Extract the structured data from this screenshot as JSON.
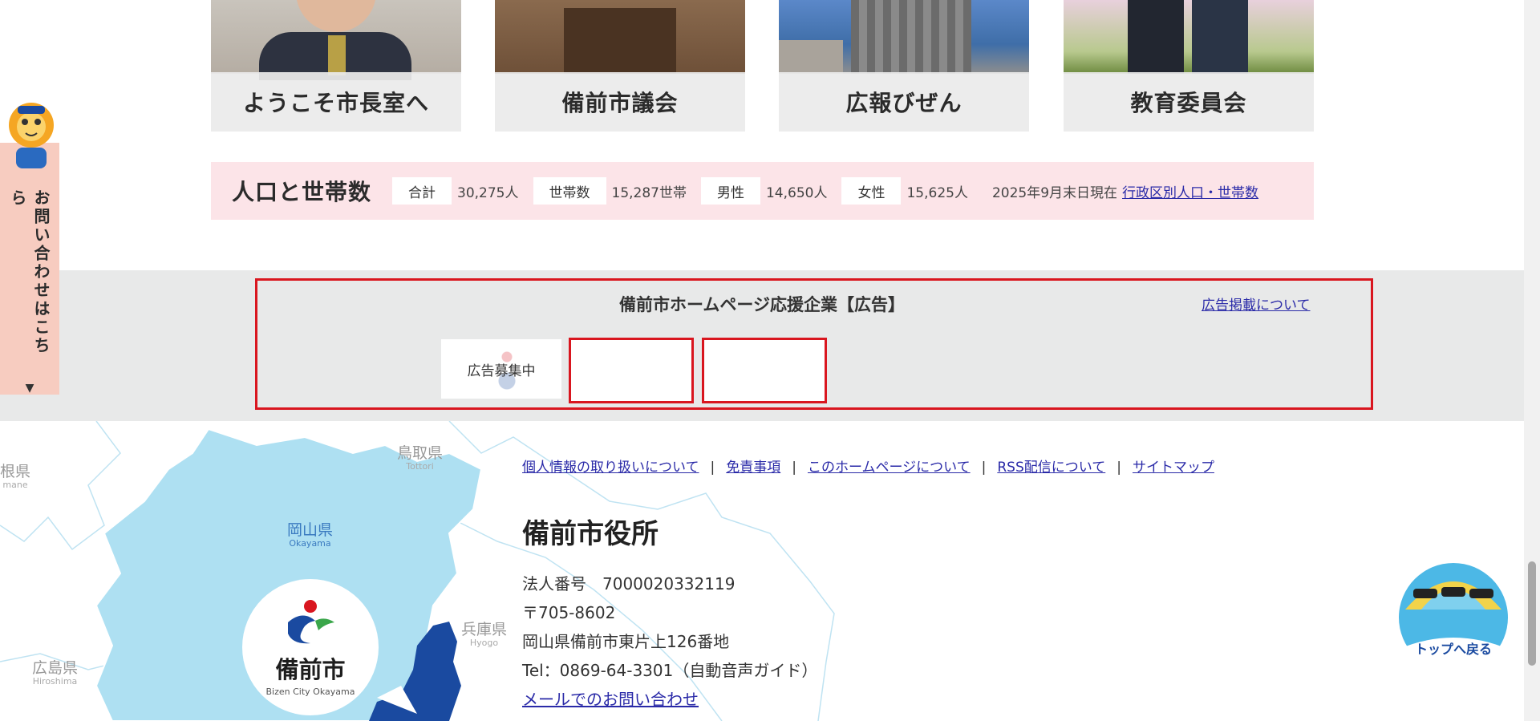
{
  "cards": [
    {
      "label": "ようこそ市長室へ"
    },
    {
      "label": "備前市議会"
    },
    {
      "label": "広報びぜん"
    },
    {
      "label": "教育委員会"
    }
  ],
  "population": {
    "title": "人口と世帯数",
    "total_label": "合計",
    "total_value": "30,275人",
    "households_label": "世帯数",
    "households_value": "15,287世帯",
    "male_label": "男性",
    "male_value": "14,650人",
    "female_label": "女性",
    "female_value": "15,625人",
    "as_of": "2025年9月末日現在",
    "link": "行政区別人口・世帯数"
  },
  "ads": {
    "title": "備前市ホームページ応援企業【広告】",
    "about_link": "広告掲載について",
    "slot1_text": "広告募集中"
  },
  "map": {
    "labels": [
      {
        "jp": "鳥取県",
        "en": "Tottori"
      },
      {
        "jp": "岡山県",
        "en": "Okayama"
      },
      {
        "jp": "兵庫県",
        "en": "Hyogo"
      },
      {
        "jp": "広島県",
        "en": "Hiroshima"
      },
      {
        "jp": "根県",
        "en": "mane"
      }
    ],
    "city_name": "備前市",
    "city_sub": "Bizen City Okayama"
  },
  "footer": {
    "links": [
      "個人情報の取り扱いについて",
      "免責事項",
      "このホームページについて",
      "RSS配信について",
      "サイトマップ"
    ],
    "separator": "|",
    "office_name": "備前市役所",
    "corp_number": "法人番号　7000020332119",
    "postal": "〒705-8602",
    "address": "岡山県備前市東片上126番地",
    "tel": "Tel：0869-64-3301（自動音声ガイド）",
    "mail_link": "メールでのお問い合わせ"
  },
  "side_tab": {
    "text": "お問い合わせはこちら",
    "arrow": "▼"
  },
  "totop": {
    "label": "トップへ戻る"
  },
  "colors": {
    "pop_bg": "#fce4e8",
    "ad_border": "#d9161f",
    "map_blue": "#aee0f2",
    "bizen_blue": "#1a4aa0",
    "side_tab_bg": "#f7ccc0"
  }
}
